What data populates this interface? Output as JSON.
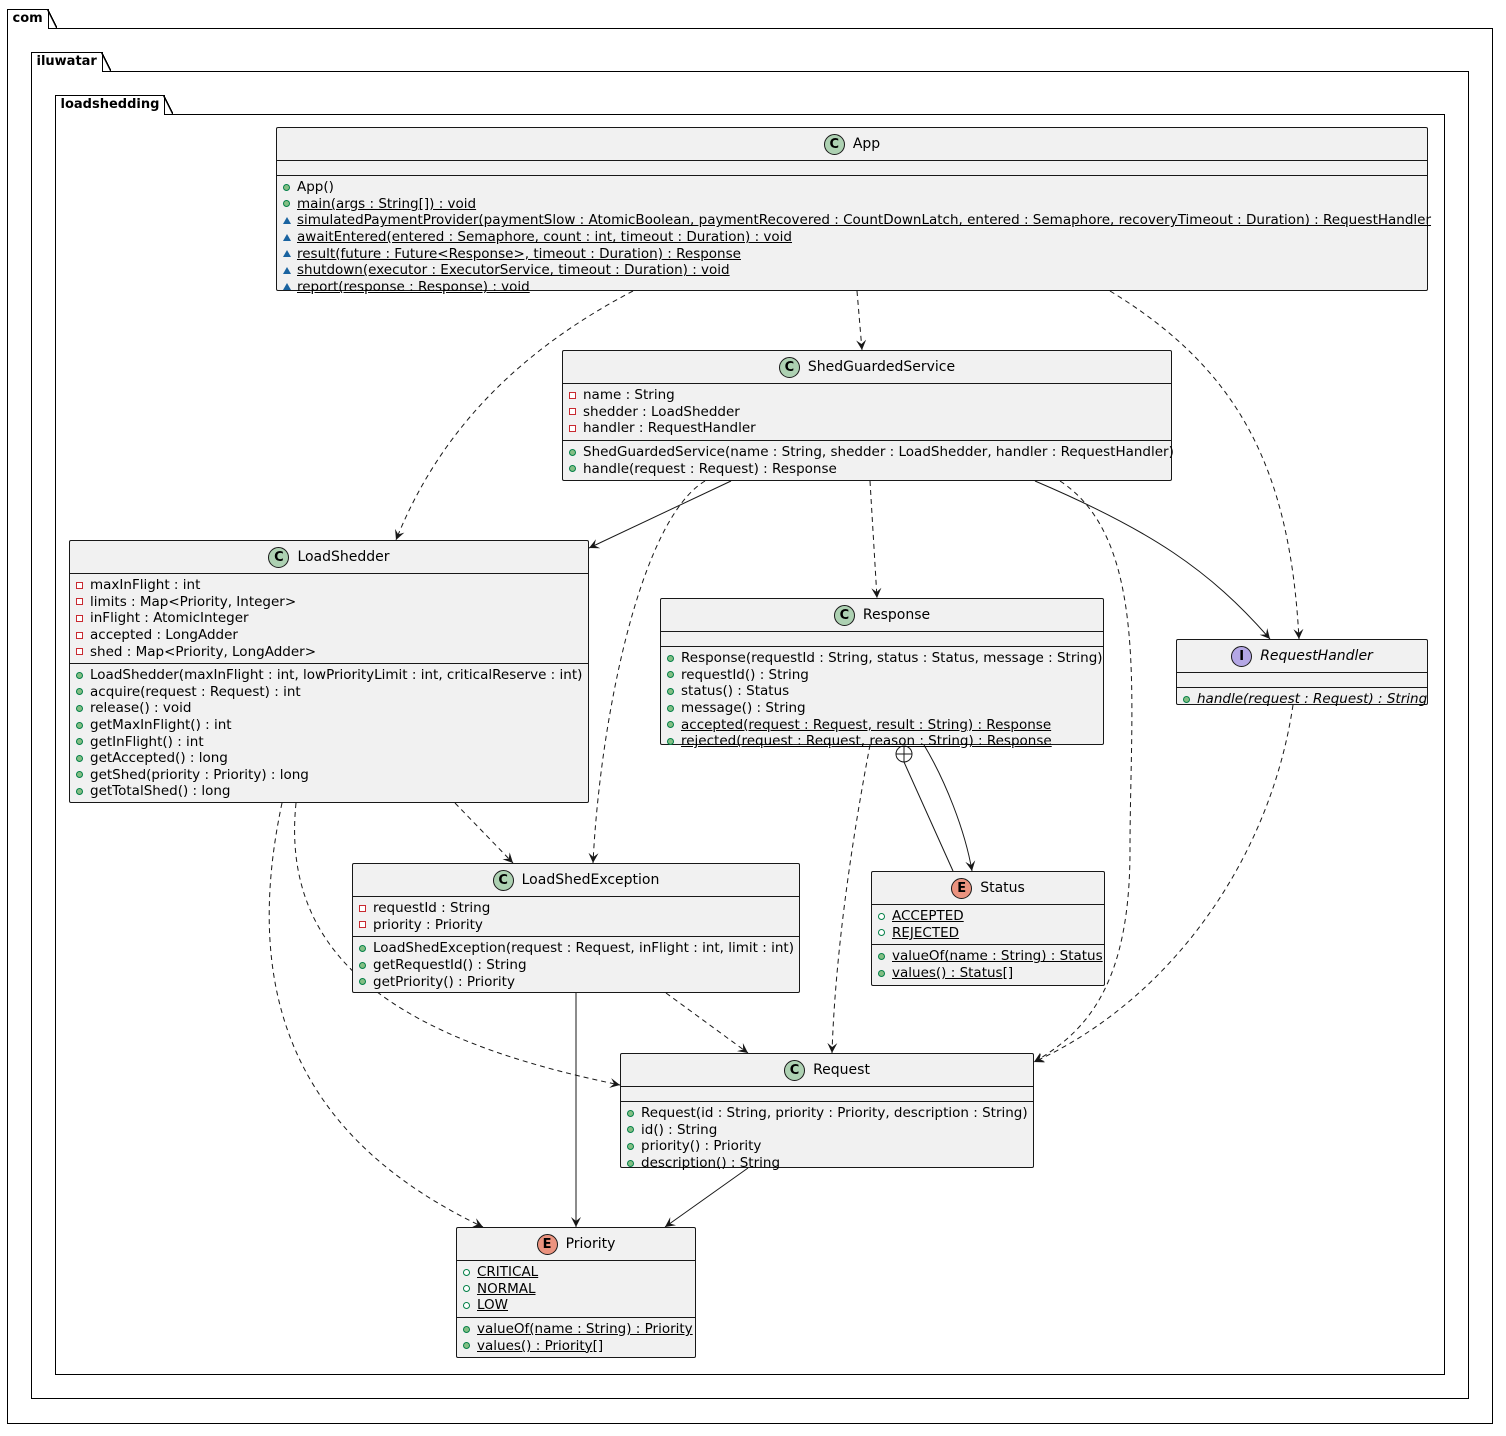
{
  "packages": {
    "outer": "com",
    "middle": "iluwatar",
    "inner": "loadshedding"
  },
  "classes": {
    "app": {
      "name": "App",
      "stereotype": "C",
      "methods": [
        "App()",
        "main(args : String[]) : void",
        "simulatedPaymentProvider(paymentSlow : AtomicBoolean, paymentRecovered : CountDownLatch, entered : Semaphore, recoveryTimeout : Duration) : RequestHandler",
        "awaitEntered(entered : Semaphore, count : int, timeout : Duration) : void",
        "result(future : Future<Response>, timeout : Duration) : Response",
        "shutdown(executor : ExecutorService, timeout : Duration) : void",
        "report(response : Response) : void"
      ]
    },
    "shed_guarded_service": {
      "name": "ShedGuardedService",
      "stereotype": "C",
      "fields": [
        "name : String",
        "shedder : LoadShedder",
        "handler : RequestHandler"
      ],
      "methods": [
        "ShedGuardedService(name : String, shedder : LoadShedder, handler : RequestHandler)",
        "handle(request : Request) : Response"
      ]
    },
    "load_shedder": {
      "name": "LoadShedder",
      "stereotype": "C",
      "fields": [
        "maxInFlight : int",
        "limits : Map<Priority, Integer>",
        "inFlight : AtomicInteger",
        "accepted : LongAdder",
        "shed : Map<Priority, LongAdder>"
      ],
      "methods": [
        "LoadShedder(maxInFlight : int, lowPriorityLimit : int, criticalReserve : int)",
        "acquire(request : Request) : int",
        "release() : void",
        "getMaxInFlight() : int",
        "getInFlight() : int",
        "getAccepted() : long",
        "getShed(priority : Priority) : long",
        "getTotalShed() : long"
      ]
    },
    "response": {
      "name": "Response",
      "stereotype": "C",
      "methods": [
        "Response(requestId : String, status : Status, message : String)",
        "requestId() : String",
        "status() : Status",
        "message() : String",
        "accepted(request : Request, result : String) : Response",
        "rejected(request : Request, reason : String) : Response"
      ]
    },
    "request_handler": {
      "name": "RequestHandler",
      "stereotype": "I",
      "methods": [
        "handle(request : Request) : String"
      ]
    },
    "load_shed_exception": {
      "name": "LoadShedException",
      "stereotype": "C",
      "fields": [
        "requestId : String",
        "priority : Priority"
      ],
      "methods": [
        "LoadShedException(request : Request, inFlight : int, limit : int)",
        "getRequestId() : String",
        "getPriority() : Priority"
      ]
    },
    "status": {
      "name": "Status",
      "stereotype": "E",
      "constants": [
        "ACCEPTED",
        "REJECTED"
      ],
      "methods": [
        "valueOf(name : String) : Status",
        "values() : Status[]"
      ]
    },
    "request": {
      "name": "Request",
      "stereotype": "C",
      "methods": [
        "Request(id : String, priority : Priority, description : String)",
        "id() : String",
        "priority() : Priority",
        "description() : String"
      ]
    },
    "priority": {
      "name": "Priority",
      "stereotype": "E",
      "constants": [
        "CRITICAL",
        "NORMAL",
        "LOW"
      ],
      "methods": [
        "valueOf(name : String) : Priority",
        "values() : Priority[]"
      ]
    }
  },
  "colors": {
    "class_fill": "#f1f1f1",
    "border": "#181818",
    "class_stereo": "#add1b2",
    "enum_stereo": "#eb937f",
    "interface_stereo": "#b4a7e5",
    "public": "#84be84",
    "private": "#c82930",
    "package_private": "#1963a0"
  }
}
